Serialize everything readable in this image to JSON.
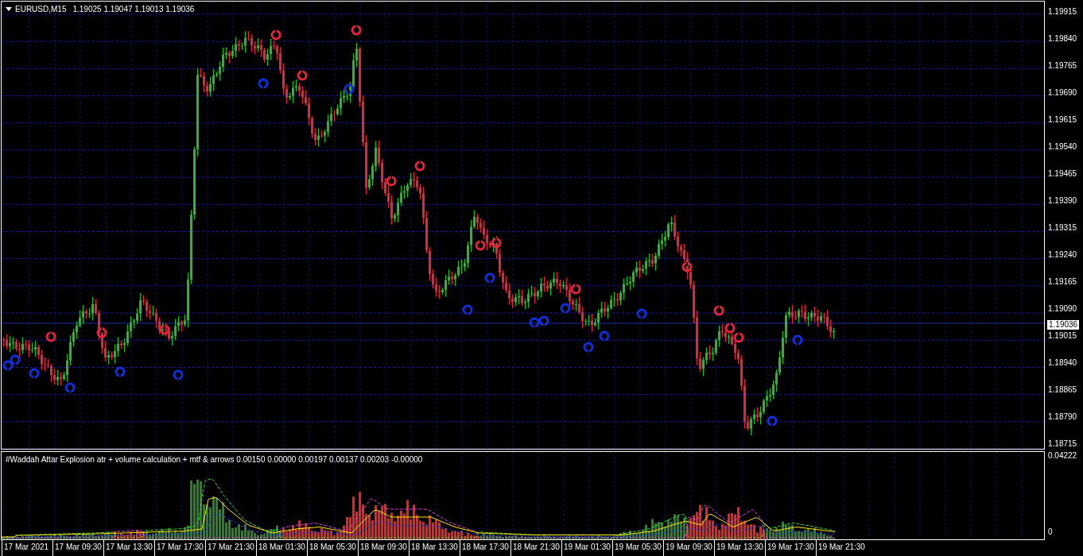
{
  "chart": {
    "title": "EURUSD,M15",
    "ohlc": "1.19025 1.19047 1.19013 1.19036"
  },
  "price_axis": [
    "1.19915",
    "1.19840",
    "1.19765",
    "1.19690",
    "1.19615",
    "1.19540",
    "1.19465",
    "1.19390",
    "1.19315",
    "1.19240",
    "1.19165",
    "1.19090",
    "1.19015",
    "1.18940",
    "1.18865",
    "1.18790",
    "1.18715"
  ],
  "current_price": "1.19036",
  "indicator": {
    "title": "#Waddah Attar Explosion atr + volume calculation + mtf & arrows 0.00150 0.00000 0.00197 0.00137 0.00203 -0.00000",
    "scale_max": "0.04222",
    "scale_min": "0"
  },
  "time_axis": [
    "17 Mar 2021",
    "17 Mar 09:30",
    "17 Mar 13:30",
    "17 Mar 17:30",
    "17 Mar 21:30",
    "18 Mar 01:30",
    "18 Mar 05:30",
    "18 Mar 09:30",
    "18 Mar 13:30",
    "18 Mar 17:30",
    "18 Mar 21:30",
    "19 Mar 01:30",
    "19 Mar 05:30",
    "19 Mar 09:30",
    "19 Mar 13:30",
    "19 Mar 17:30",
    "19 Mar 21:30"
  ]
}
